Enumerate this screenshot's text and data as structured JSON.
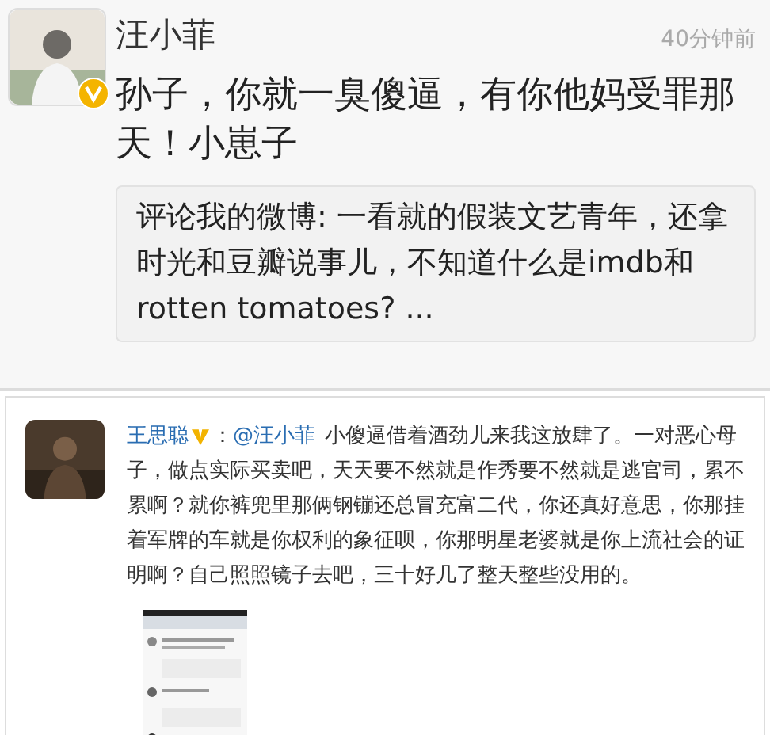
{
  "post": {
    "author": "汪小菲",
    "verified": true,
    "time": "40分钟前",
    "text": "孙子，你就一臭傻逼，有你他妈受罪那天！小崽子",
    "quote": "评论我的微博: 一看就的假装文艺青年，还拿时光和豆瓣说事儿，不知道什么是imdb和rotten tomatoes?  ..."
  },
  "repost": {
    "author": "王思聪",
    "verified": true,
    "separator": "：",
    "mention": "@汪小菲",
    "text": "小傻逼借着酒劲儿来我这放肆了。一对恶心母子，做点实际买卖吧，天天要不然就是作秀要不然就是逃官司，累不累啊？就你裤兜里那俩钢镚还总冒充富二代，你还真好意思，你那挂着军牌的车就是你权利的象征呗，你那明星老婆就是你上流社会的证明啊？自己照照镜子去吧，三十好几了整天整些没用的。"
  }
}
